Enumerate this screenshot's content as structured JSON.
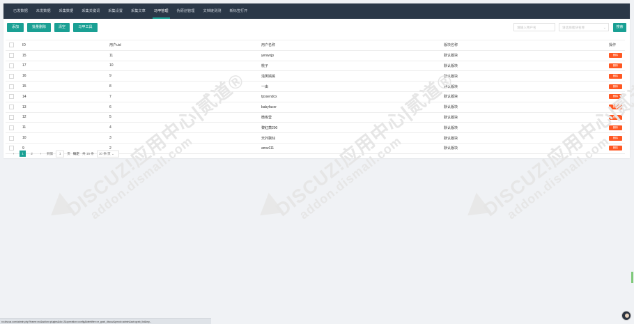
{
  "nav": {
    "tabs": [
      {
        "label": "已发数据",
        "active": false
      },
      {
        "label": "未发数据",
        "active": false
      },
      {
        "label": "采集数据",
        "active": false
      },
      {
        "label": "采集关键词",
        "active": false
      },
      {
        "label": "采集设置",
        "active": false
      },
      {
        "label": "采集文章",
        "active": false
      },
      {
        "label": "马甲管理",
        "active": true
      },
      {
        "label": "伪原创管理",
        "active": false
      },
      {
        "label": "文档链测测",
        "active": false
      },
      {
        "label": "新标签打开",
        "active": false
      }
    ]
  },
  "toolbar": {
    "add_label": "添加",
    "batch_delete_label": "批量删除",
    "clear_label": "清空",
    "vest_tool_label": "马甲工具",
    "search_placeholder": "请输入用户名",
    "board_placeholder": "请选择版块名称",
    "search_label": "搜索"
  },
  "table": {
    "headers": [
      "ID",
      "用户uid",
      "用户名称",
      "版块名称",
      "操作"
    ],
    "rows": [
      {
        "id": "15",
        "uid": "11",
        "name": "yenwxjp",
        "board": "默认版块"
      },
      {
        "id": "17",
        "uid": "10",
        "name": "桃子",
        "board": "默认版块"
      },
      {
        "id": "16",
        "uid": "9",
        "name": "浅笑嫣嫣",
        "board": "默认版块"
      },
      {
        "id": "15",
        "uid": "8",
        "name": "一由",
        "board": "默认版块"
      },
      {
        "id": "14",
        "uid": "7",
        "name": "tpxsendcx",
        "board": "默认版块"
      },
      {
        "id": "13",
        "uid": "6",
        "name": "babyfacer",
        "board": "默认版块"
      },
      {
        "id": "12",
        "uid": "5",
        "name": "微练营",
        "board": "默认版块"
      },
      {
        "id": "11",
        "uid": "4",
        "name": "黎紅萧200",
        "board": "默认版块"
      },
      {
        "id": "10",
        "uid": "3",
        "name": "天外飘仙",
        "board": "默认版块"
      },
      {
        "id": "9",
        "uid": "2",
        "name": "amw111",
        "board": "默认版块"
      }
    ],
    "delete_label": "删除"
  },
  "pagination": {
    "prev": "‹",
    "pages": [
      "1",
      "2"
    ],
    "next": "›",
    "goto_label": "到第",
    "goto_value": "1",
    "page_unit": "页",
    "confirm_label": "确定",
    "total_label": "共 15 条",
    "page_size_label": "10 条/页"
  },
  "watermark": {
    "line1": "DISCUZ!应用中心|贰道®",
    "line2": "addon.dismall.com"
  },
  "statusbar": {
    "url": "xx.discuz.com/admin.php?frame=no&action=plugins&do=2&operation=config&identifier=xr_grab_discuz&pmod=admin&act=grab_list&my..."
  }
}
